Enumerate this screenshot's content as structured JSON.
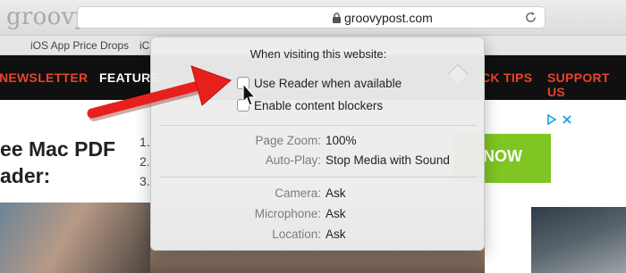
{
  "watermark": "groovyPost.com",
  "browser": {
    "address": "groovypost.com",
    "bookmarks": [
      "iOS App Price Drops",
      "iC"
    ]
  },
  "site_nav": {
    "items": [
      {
        "label": "NEWSLETTER",
        "color": "#e8432b"
      },
      {
        "label": "FEATURE",
        "color": "#ffffff"
      },
      {
        "label": "CK TIPS",
        "color": "#e8432b"
      },
      {
        "label": "SUPPORT US",
        "color": "#e8432b"
      }
    ]
  },
  "ad": {
    "headline_line1": "ee Mac PDF",
    "headline_line2": "ader:",
    "list": [
      "1.",
      "2.",
      "3."
    ],
    "cta": "NOW",
    "cta_color": "#80c623"
  },
  "popover": {
    "title": "When visiting this website:",
    "checkboxes": [
      {
        "label": "Use Reader when available",
        "checked": false
      },
      {
        "label": "Enable content blockers",
        "checked": false
      }
    ],
    "settings_group1": [
      {
        "label": "Page Zoom:",
        "value": "100%"
      },
      {
        "label": "Auto-Play:",
        "value": "Stop Media with Sound"
      }
    ],
    "settings_group2": [
      {
        "label": "Camera:",
        "value": "Ask"
      },
      {
        "label": "Microphone:",
        "value": "Ask"
      },
      {
        "label": "Location:",
        "value": "Ask"
      }
    ]
  },
  "annotation_color": "#e8201c"
}
